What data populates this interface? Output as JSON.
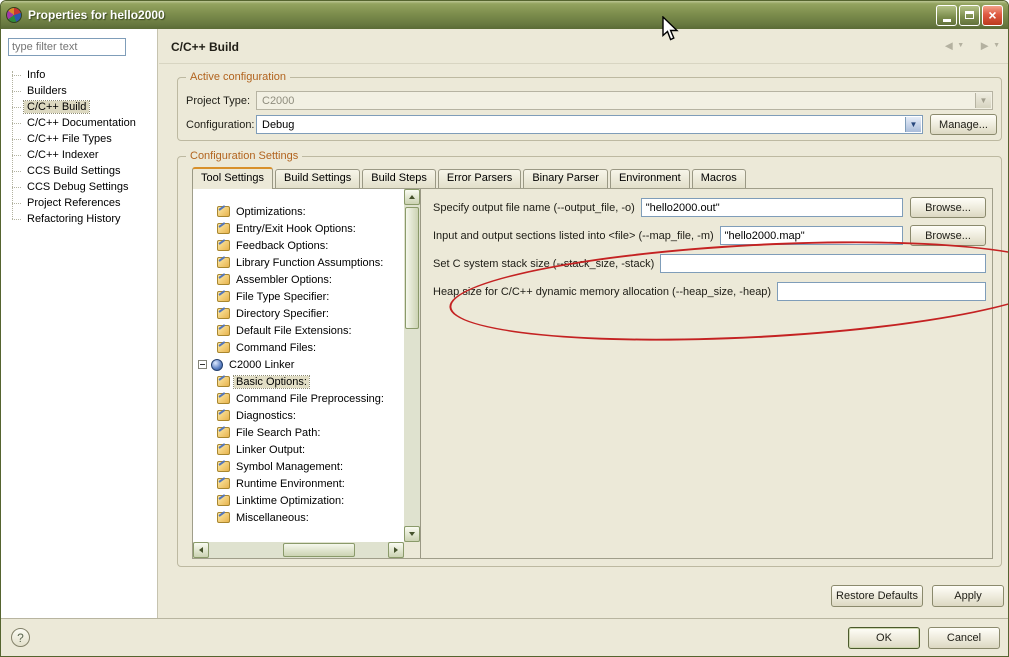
{
  "window": {
    "title": "Properties for hello2000"
  },
  "sidebar": {
    "filter_placeholder": "type filter text",
    "items": [
      "Info",
      "Builders",
      "C/C++ Build",
      "C/C++ Documentation",
      "C/C++ File Types",
      "C/C++ Indexer",
      "CCS Build Settings",
      "CCS Debug Settings",
      "Project References",
      "Refactoring History"
    ],
    "selected": "C/C++ Build"
  },
  "header": {
    "title": "C/C++ Build"
  },
  "active_config": {
    "legend": "Active configuration",
    "project_type_label": "Project Type:",
    "project_type_value": "C2000",
    "configuration_label": "Configuration:",
    "configuration_value": "Debug",
    "manage_button": "Manage..."
  },
  "config_settings": {
    "legend": "Configuration Settings",
    "tabs": [
      "Tool Settings",
      "Build Settings",
      "Build Steps",
      "Error Parsers",
      "Binary Parser",
      "Environment",
      "Macros"
    ],
    "active_tab": "Tool Settings",
    "tree_top": [
      "Optimizations:",
      "Entry/Exit Hook Options:",
      "Feedback Options:",
      "Library Function Assumptions:",
      "Assembler Options:",
      "File Type Specifier:",
      "Directory Specifier:",
      "Default File Extensions:",
      "Command Files:"
    ],
    "linker_node": "C2000 Linker",
    "linker_children": [
      "Basic Options:",
      "Command File Preprocessing:",
      "Diagnostics:",
      "File Search Path:",
      "Linker Output:",
      "Symbol Management:",
      "Runtime Environment:",
      "Linktime Optimization:",
      "Miscellaneous:"
    ],
    "selected_tree_item": "Basic Options:",
    "fields": [
      {
        "label": "Specify output file name (--output_file, -o)",
        "value": "\"hello2000.out\"",
        "browse": "Browse..."
      },
      {
        "label": "Input and output sections listed into <file> (--map_file, -m)",
        "value": "\"hello2000.map\"",
        "browse": "Browse..."
      },
      {
        "label": "Set C system stack size (--stack_size, -stack)",
        "value": ""
      },
      {
        "label": "Heap size for C/C++ dynamic memory allocation (--heap_size, -heap)",
        "value": ""
      }
    ]
  },
  "footer": {
    "restore": "Restore Defaults",
    "apply": "Apply",
    "ok": "OK",
    "cancel": "Cancel",
    "help": "?"
  }
}
